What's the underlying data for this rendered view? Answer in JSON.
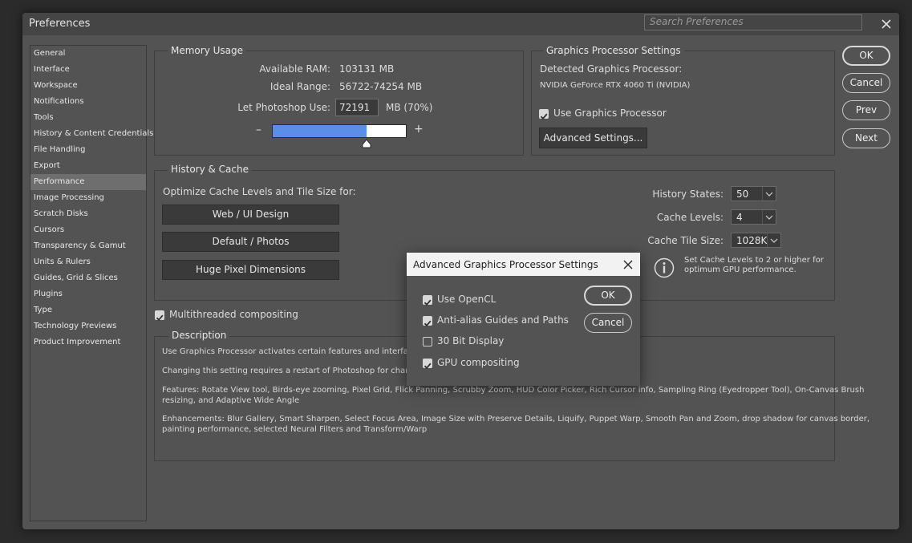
{
  "window": {
    "title": "Preferences",
    "search_placeholder": "Search Preferences",
    "close_glyph": "✕"
  },
  "sidebar": {
    "selected": "Performance",
    "items": [
      "General",
      "Interface",
      "Workspace",
      "Notifications",
      "Tools",
      "History & Content Credentials",
      "File Handling",
      "Export",
      "Performance",
      "Image Processing",
      "Scratch Disks",
      "Cursors",
      "Transparency & Gamut",
      "Units & Rulers",
      "Guides, Grid & Slices",
      "Plugins",
      "Type",
      "Technology Previews",
      "Product Improvement"
    ]
  },
  "memory": {
    "legend": "Memory Usage",
    "available_label": "Available RAM:",
    "available_value": "103131 MB",
    "ideal_label": "Ideal Range:",
    "ideal_value": "56722-74254 MB",
    "use_label": "Let Photoshop Use:",
    "use_value": "72191",
    "use_unit": "MB (70%)",
    "minus": "–",
    "plus": "+",
    "slider_fraction": 0.7,
    "slider_fill_color": "#5b8ee6"
  },
  "gpu": {
    "legend": "Graphics Processor Settings",
    "detected_label": "Detected Graphics Processor:",
    "detected_value": "NVIDIA GeForce RTX 4060 Ti (NVIDIA)",
    "use_gpu_label": "Use Graphics Processor",
    "use_gpu_checked": true,
    "advanced_button": "Advanced Settings..."
  },
  "buttons": {
    "ok": "OK",
    "cancel": "Cancel",
    "prev": "Prev",
    "next": "Next"
  },
  "history": {
    "legend": "History & Cache",
    "optimize_label": "Optimize Cache Levels and Tile Size for:",
    "preset_buttons": [
      "Web / UI Design",
      "Default / Photos",
      "Huge Pixel Dimensions"
    ],
    "history_states_label": "History States:",
    "history_states_value": "50",
    "cache_levels_label": "Cache Levels:",
    "cache_levels_value": "4",
    "tile_size_label": "Cache Tile Size:",
    "tile_size_value": "1028K",
    "info_line1": "Set Cache Levels to 2 or higher for",
    "info_line2": "optimum GPU performance."
  },
  "multithreaded": {
    "label": "Multithreaded compositing",
    "checked": true
  },
  "description": {
    "legend": "Description",
    "lines": [
      "Use Graphics Processor activates certain features and interface enha",
      "Changing this setting requires a restart of Photoshop for changes to",
      "Features: Rotate View tool, Birds-eye zooming, Pixel Grid, Flick Panning, Scrubby Zoom, HUD Color Picker, Rich Cursor info, Sampling Ring (Eyedropper Tool), On-Canvas Brush",
      "resizing, and Adaptive Wide Angle",
      "Enhancements: Blur Gallery, Smart Sharpen, Select Focus Area, Image Size with Preserve Details, Liquify, Puppet Warp, Smooth Pan and Zoom, drop shadow for canvas border,",
      "painting performance, selected Neural Filters and Transform/Warp"
    ]
  },
  "dialog": {
    "title": "Advanced Graphics Processor Settings",
    "close_glyph": "✕",
    "options": [
      {
        "label": "Use OpenCL",
        "checked": true
      },
      {
        "label": "Anti-alias Guides and Paths",
        "checked": true
      },
      {
        "label": "30 Bit Display",
        "checked": false
      },
      {
        "label": "GPU compositing",
        "checked": true
      }
    ],
    "ok": "OK",
    "cancel": "Cancel"
  }
}
